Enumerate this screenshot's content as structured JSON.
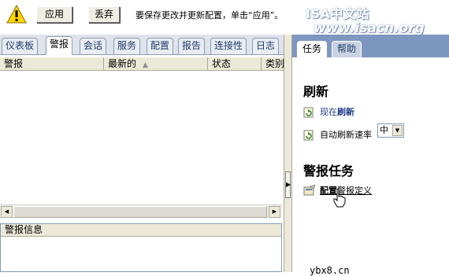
{
  "topbar": {
    "apply_label": "应用",
    "discard_label": "丢弃",
    "message": "要保存更改并更新配置，单击“应用”。",
    "watermark_title": "ISA中文站",
    "watermark_url": "www.isacn.org"
  },
  "left": {
    "tabs": [
      "仪表板",
      "警报",
      "会话",
      "服务",
      "配置",
      "报告",
      "连接性",
      "日志"
    ],
    "active_tab": "警报",
    "columns": [
      "警报",
      "最新的",
      "状态",
      "类别"
    ],
    "sorted_column": "最新的",
    "sort_direction": "ascending",
    "info_panel_title": "警报信息"
  },
  "right": {
    "tabs": [
      "任务",
      "帮助"
    ],
    "active_tab": "任务",
    "refresh_section": "刷新",
    "refresh_now_prefix": "现在",
    "refresh_now_bold": "刷新",
    "auto_refresh_label": "自动刷新速率",
    "auto_refresh_value": "中",
    "alert_tasks_section": "警报任务",
    "configure_bold": "配置",
    "configure_rest": "警报定义",
    "watermark_bottom": "ybx8.cn"
  },
  "colors": {
    "tabstrip_background": "#dfe3ea",
    "taskpane_header": "#7e97c0",
    "link_blue": "#1f3a8a"
  },
  "icons": [
    "warning-icon",
    "refresh-task-icon",
    "auto-refresh-task-icon",
    "configure-alerts-icon",
    "hand-cursor-icon",
    "sort-ascending-icon",
    "collapse-arrow-icon",
    "dropdown-arrow-icon"
  ]
}
